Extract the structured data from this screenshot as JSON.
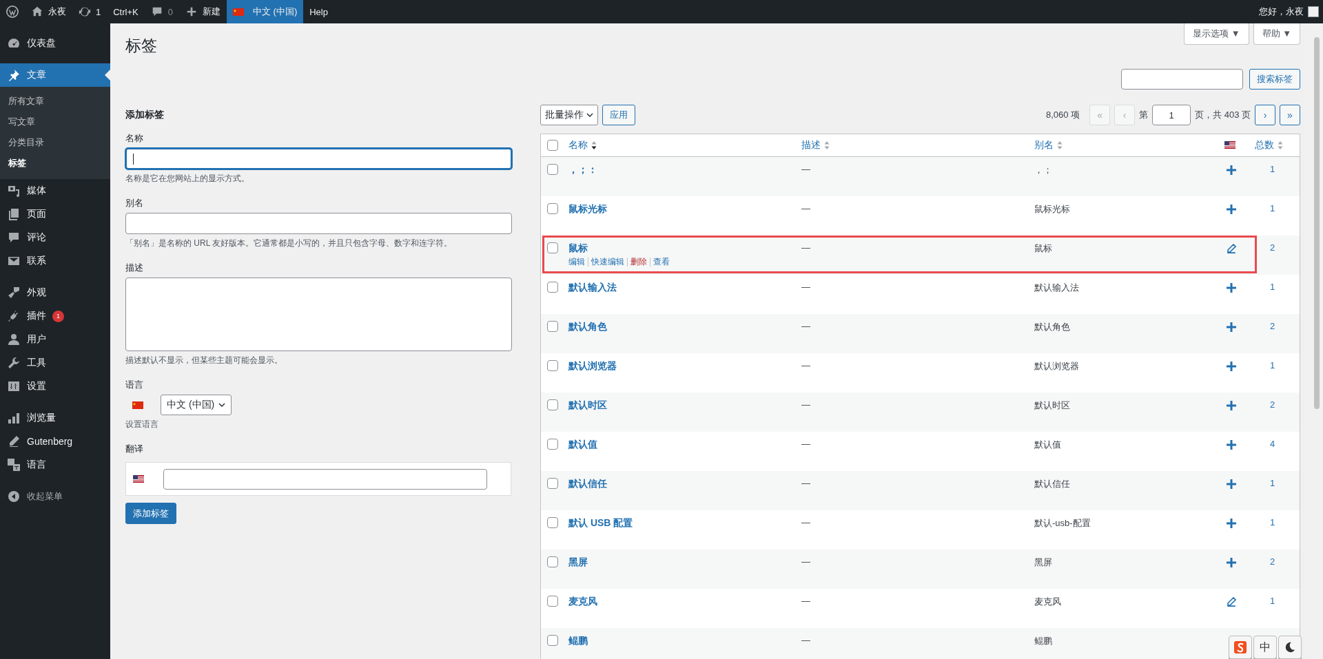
{
  "admin_bar": {
    "items": [
      {
        "kind": "logo"
      },
      {
        "kind": "home",
        "label": "永夜"
      },
      {
        "kind": "updates",
        "label": "1"
      },
      {
        "kind": "text",
        "label": "Ctrl+K"
      },
      {
        "kind": "comments",
        "label": "0"
      },
      {
        "kind": "new",
        "label": "新建"
      },
      {
        "kind": "language",
        "label": "中文 (中国)",
        "selected": true
      },
      {
        "kind": "text",
        "label": "Help"
      }
    ],
    "greeting": "您好，永夜"
  },
  "sidebar": {
    "groups": [
      [
        {
          "kind": "dashboard",
          "label": "仪表盘",
          "selected": false
        }
      ],
      [
        {
          "kind": "pin",
          "label": "文章",
          "selected": true,
          "children": [
            {
              "label": "所有文章",
              "selected": false
            },
            {
              "label": "写文章",
              "selected": false
            },
            {
              "label": "分类目录",
              "selected": false
            },
            {
              "label": "标签",
              "selected": true
            }
          ]
        },
        {
          "kind": "media",
          "label": "媒体",
          "selected": false
        },
        {
          "kind": "pages",
          "label": "页面",
          "selected": false
        },
        {
          "kind": "comments",
          "label": "评论",
          "selected": false
        },
        {
          "kind": "mail",
          "label": "联系",
          "selected": false
        }
      ],
      [
        {
          "kind": "appearance",
          "label": "外观",
          "selected": false
        },
        {
          "kind": "plugins",
          "label": "插件",
          "selected": false,
          "badge": "1"
        },
        {
          "kind": "users",
          "label": "用户",
          "selected": false
        },
        {
          "kind": "tools",
          "label": "工具",
          "selected": false
        },
        {
          "kind": "settings",
          "label": "设置",
          "selected": false
        }
      ],
      [
        {
          "kind": "stats",
          "label": "浏览量",
          "selected": false
        },
        {
          "kind": "gutenberg",
          "label": "Gutenberg",
          "selected": false
        },
        {
          "kind": "languages",
          "label": "语言",
          "selected": false
        }
      ]
    ],
    "collapse": "收起菜单"
  },
  "page_title": "标签",
  "screen_buttons": [
    "显示选项 ▼",
    "帮助 ▼"
  ],
  "search": {
    "button": "搜索标签"
  },
  "add_form": {
    "title": "添加标签",
    "fields": [
      {
        "kind": "input",
        "label": "名称",
        "hint": "名称是它在您网站上的显示方式。",
        "focused": true
      },
      {
        "kind": "input",
        "label": "别名",
        "hint": "「别名」是名称的 URL 友好版本。它通常都是小写的，并且只包含字母、数字和连字符。"
      },
      {
        "kind": "textarea",
        "label": "描述",
        "hint": "描述默认不显示，但某些主题可能会显示。"
      },
      {
        "kind": "language",
        "label": "语言",
        "value": "中文 (中国)",
        "hint": "设置语言"
      },
      {
        "kind": "translation",
        "label": "翻译"
      }
    ],
    "submit": "添加标签"
  },
  "tablenav": {
    "bulk": "批量操作",
    "apply": "应用",
    "count": "8,060 项",
    "first": "«",
    "prev": "‹",
    "page_prefix": "第",
    "page": "1",
    "page_suffix": "页，共 403 页",
    "next": "›",
    "last": "»"
  },
  "table": {
    "select_all_checked": false,
    "columns": [
      {
        "kind": "text",
        "label": "名称",
        "sorted": true
      },
      {
        "kind": "text",
        "label": "描述",
        "sorted": false
      },
      {
        "kind": "text",
        "label": "别名",
        "sorted": false
      },
      {
        "kind": "flag"
      },
      {
        "kind": "text",
        "label": "总数",
        "sorted": false
      }
    ],
    "rows": [
      {
        "name": "，；：",
        "description": "—",
        "slug": "，；",
        "translated": false,
        "count": "1",
        "checked": false,
        "highlighted": false
      },
      {
        "name": "鼠标光标",
        "description": "—",
        "slug": "鼠标光标",
        "translated": false,
        "count": "1",
        "checked": false,
        "highlighted": false
      },
      {
        "name": "鼠标",
        "description": "—",
        "slug": "鼠标",
        "translated": true,
        "count": "2",
        "checked": false,
        "highlighted": true,
        "actions": [
          {
            "label": "编辑",
            "kind": "normal"
          },
          {
            "label": "快速编辑",
            "kind": "normal"
          },
          {
            "label": "删除",
            "kind": "delete"
          },
          {
            "label": "查看",
            "kind": "normal"
          }
        ]
      },
      {
        "name": "默认输入法",
        "description": "—",
        "slug": "默认输入法",
        "translated": false,
        "count": "1",
        "checked": false,
        "highlighted": false
      },
      {
        "name": "默认角色",
        "description": "—",
        "slug": "默认角色",
        "translated": false,
        "count": "2",
        "checked": false,
        "highlighted": false
      },
      {
        "name": "默认浏览器",
        "description": "—",
        "slug": "默认浏览器",
        "translated": false,
        "count": "1",
        "checked": false,
        "highlighted": false
      },
      {
        "name": "默认时区",
        "description": "—",
        "slug": "默认时区",
        "translated": false,
        "count": "2",
        "checked": false,
        "highlighted": false
      },
      {
        "name": "默认值",
        "description": "—",
        "slug": "默认值",
        "translated": false,
        "count": "4",
        "checked": false,
        "highlighted": false
      },
      {
        "name": "默认信任",
        "description": "—",
        "slug": "默认信任",
        "translated": false,
        "count": "1",
        "checked": false,
        "highlighted": false
      },
      {
        "name": "默认 USB 配置",
        "description": "—",
        "slug": "默认-usb-配置",
        "translated": false,
        "count": "1",
        "checked": false,
        "highlighted": false
      },
      {
        "name": "黑屏",
        "description": "—",
        "slug": "黑屏",
        "translated": false,
        "count": "2",
        "checked": false,
        "highlighted": false
      },
      {
        "name": "麦克风",
        "description": "—",
        "slug": "麦克风",
        "translated": true,
        "count": "1",
        "checked": false,
        "highlighted": false
      },
      {
        "name": "鲲鹏",
        "description": "—",
        "slug": "鲲鹏",
        "checked": false,
        "highlighted": false
      }
    ]
  },
  "ime_toolbar": {
    "mode": "中"
  }
}
